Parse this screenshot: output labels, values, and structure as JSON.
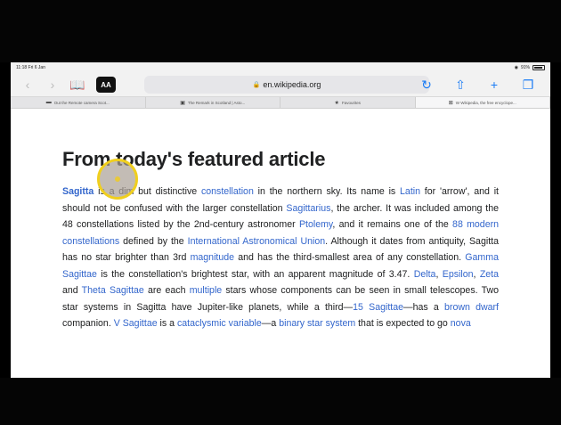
{
  "status": {
    "time": "11:18 Fri 6 Jan",
    "battery": "91%"
  },
  "toolbar": {
    "url": "en.wikipedia.org",
    "reader_label": "AA"
  },
  "tabs": [
    {
      "title": "Out the Remote camera Scot..."
    },
    {
      "title": "The Remark in Scotland | Asto..."
    },
    {
      "title": "Favourites"
    },
    {
      "title": "W Wikipedia, the free encyclope..."
    }
  ],
  "article": {
    "heading": "From today's featured article",
    "t1": "Sagitta",
    "t2": " is a dim but distinctive ",
    "t3": "constellation",
    "t4": " in the northern sky. Its name is ",
    "t5": "Latin",
    "t6": " for 'arrow', and it should not be confused with the larger constellation ",
    "t7": "Sagittarius",
    "t8": ", the archer. It was included among the 48 constellations listed by the 2nd-century astronomer ",
    "t9": "Ptolemy",
    "t10": ", and it remains one of the ",
    "t11": "88 modern constellations",
    "t12": " defined by the ",
    "t13": "International Astronomical Union",
    "t14": ". Although it dates from antiquity, Sagitta has no star brighter than 3rd ",
    "t15": "magnitude",
    "t16": " and has the third-smallest area of any constellation. ",
    "t17": "Gamma Sagittae",
    "t18": " is the constellation's brightest star, with an apparent magnitude of 3.47. ",
    "t19": "Delta",
    "t20": ", ",
    "t21": "Epsilon",
    "t22": ", ",
    "t23": "Zeta",
    "t24": " and ",
    "t25": "Theta Sagittae",
    "t26": " are each ",
    "t27": "multiple",
    "t28": " stars whose components can be seen in small telescopes. Two star systems in Sagitta have Jupiter-like planets, while a third—",
    "t29": "15 Sagittae",
    "t30": "—has a ",
    "t31": "brown dwarf",
    "t32": " companion. ",
    "t33": "V Sagittae",
    "t34": " is a ",
    "t35": "cataclysmic variable",
    "t36": "—a ",
    "t37": "binary star system",
    "t38": " that is expected to go ",
    "t39": "nova"
  }
}
